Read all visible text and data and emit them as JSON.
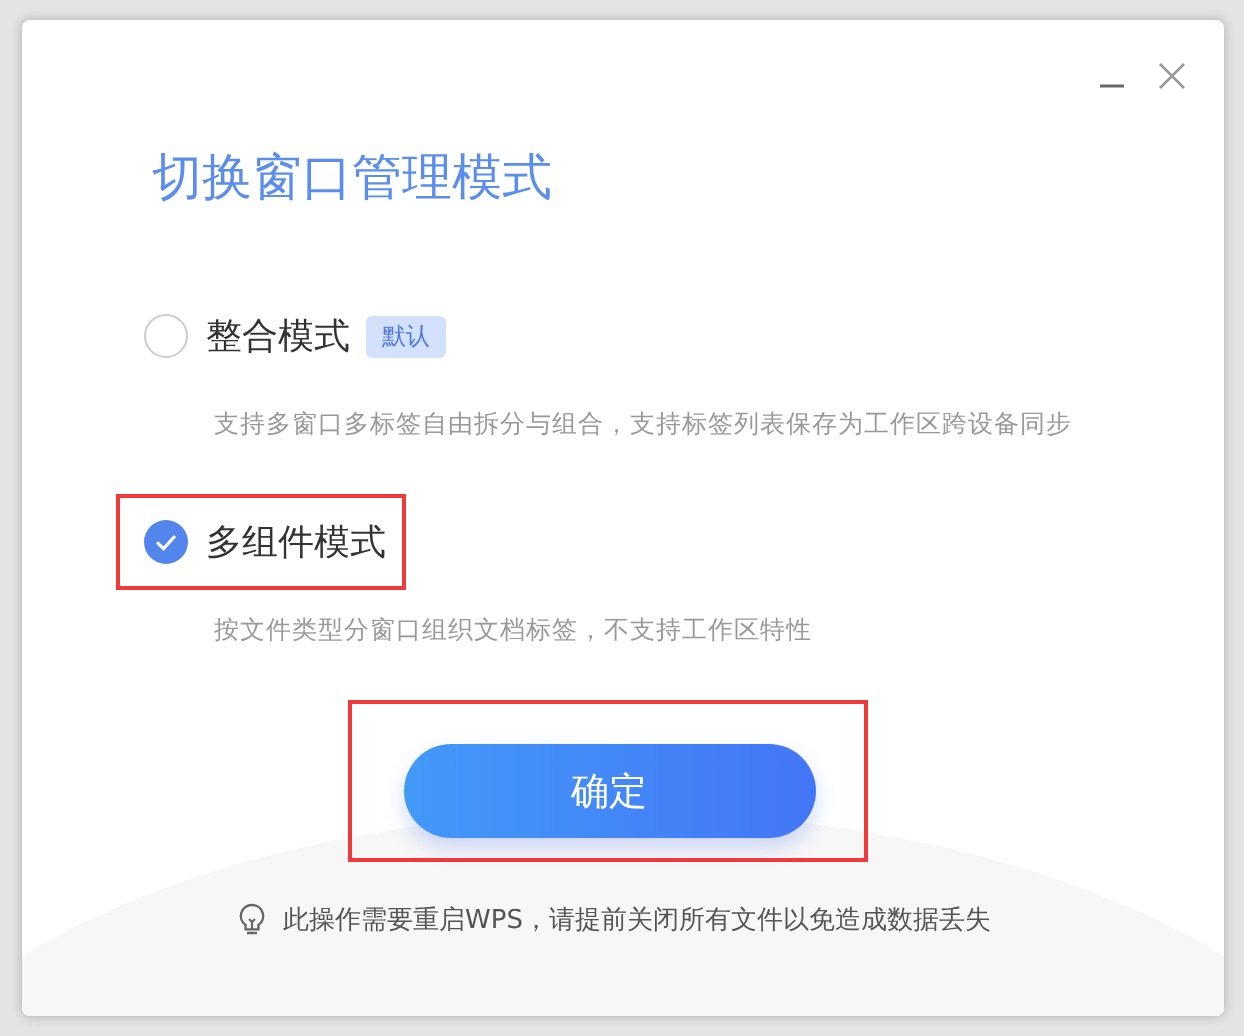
{
  "dialog": {
    "title": "切换窗口管理模式",
    "options": [
      {
        "label": "整合模式",
        "badge": "默认",
        "description": "支持多窗口多标签自由拆分与组合，支持标签列表保存为工作区跨设备同步",
        "selected": false,
        "highlighted": false
      },
      {
        "label": "多组件模式",
        "description": "按文件类型分窗口组织文档标签，不支持工作区特性",
        "selected": true,
        "highlighted": true
      }
    ],
    "confirm_button": {
      "label": "确定",
      "highlighted": true
    },
    "hint": "此操作需要重启WPS，请提前关闭所有文件以免造成数据丢失"
  }
}
